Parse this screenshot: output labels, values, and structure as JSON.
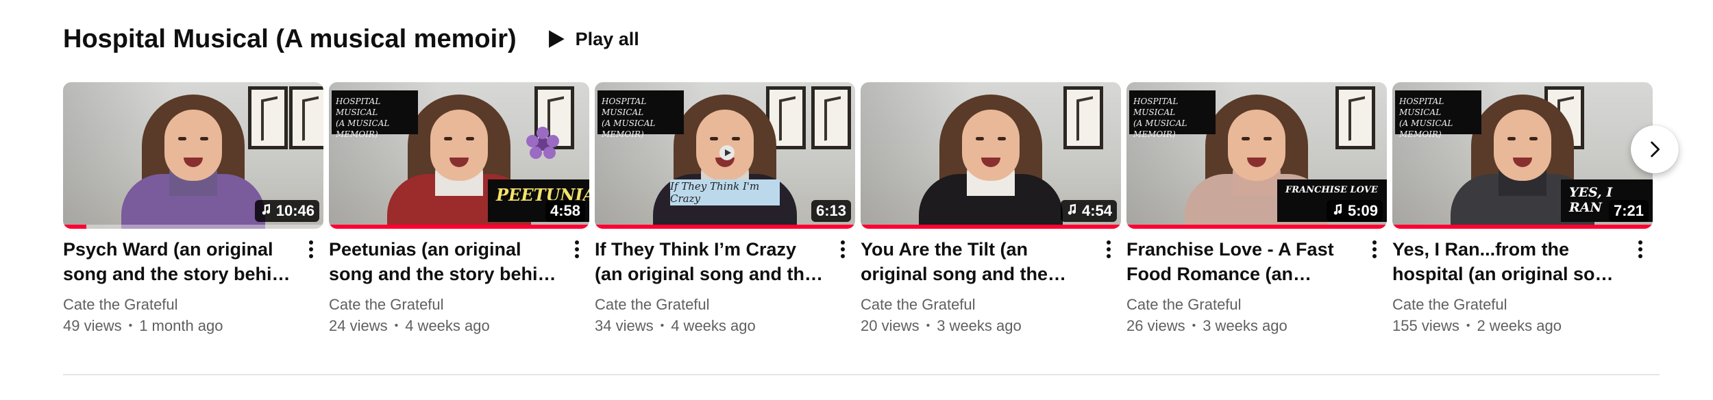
{
  "shelf": {
    "title": "Hospital Musical (A musical memoir)",
    "play_all_label": "Play all",
    "play_icon": "play-icon",
    "next_icon": "chevron-right-icon"
  },
  "colors": {
    "progress": "#ff0033",
    "text_primary": "#0f0f0f",
    "text_secondary": "#606060"
  },
  "videos": [
    {
      "title": "Psych Ward (an original song and the story behind it)",
      "duration": "10:46",
      "music_note": true,
      "overlay_text": "",
      "banner_text": "",
      "channel": "Cate the Grateful",
      "views": "49 views",
      "age": "1 month ago",
      "watched_fraction": 0.09
    },
    {
      "title": "Peetunias (an original song and the story behind it)",
      "duration": "4:58",
      "music_note": false,
      "overlay_text": "HOSPITAL MUSICAL\n(A MUSICAL MEMOIR)",
      "banner_text": "PEETUNIAS",
      "channel": "Cate the Grateful",
      "views": "24 views",
      "age": "4 weeks ago",
      "watched_fraction": 1.0
    },
    {
      "title": "If They Think I’m Crazy (an original song and the story behind it)",
      "duration": "6:13",
      "music_note": false,
      "overlay_text": "HOSPITAL MUSICAL\n(A MUSICAL MEMOIR)",
      "banner_text": "If They Think I'm Crazy",
      "channel": "Cate the Grateful",
      "views": "34 views",
      "age": "4 weeks ago",
      "watched_fraction": 1.0
    },
    {
      "title": "You Are the Tilt (an original song and the story behind it)",
      "duration": "4:54",
      "music_note": true,
      "overlay_text": "",
      "banner_text": "",
      "channel": "Cate the Grateful",
      "views": "20 views",
      "age": "3 weeks ago",
      "watched_fraction": 1.0
    },
    {
      "title": "Franchise Love - A Fast Food Romance (an original song)",
      "duration": "5:09",
      "music_note": true,
      "overlay_text": "HOSPITAL MUSICAL\n(A MUSICAL MEMOIR)",
      "banner_text": "FRANCHISE LOVE",
      "channel": "Cate the Grateful",
      "views": "26 views",
      "age": "3 weeks ago",
      "watched_fraction": 1.0
    },
    {
      "title": "Yes, I Ran...from the hospital (an original song and the story behind it)",
      "duration": "7:21",
      "music_note": false,
      "overlay_text": "HOSPITAL MUSICAL\n(A MUSICAL MEMOIR)",
      "banner_text": "YES, I RAN",
      "channel": "Cate the Grateful",
      "views": "155 views",
      "age": "2 weeks ago",
      "watched_fraction": 1.0
    }
  ]
}
